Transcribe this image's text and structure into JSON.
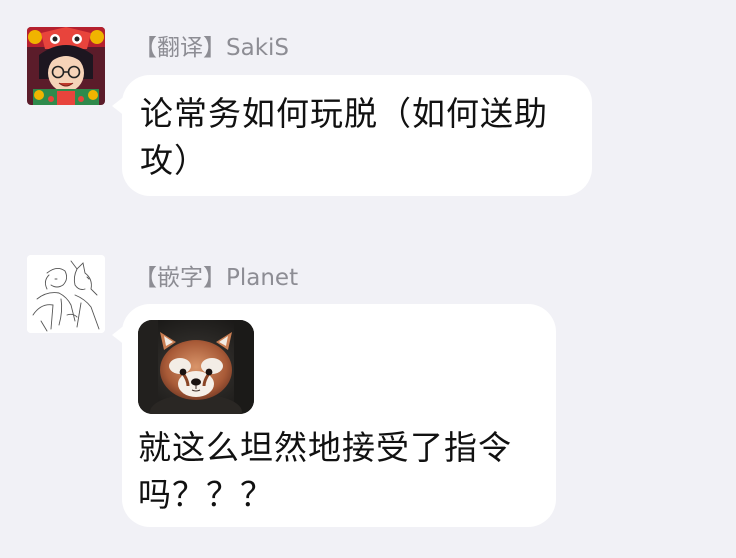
{
  "messages": [
    {
      "sender_label": "【翻译】SakiS",
      "text": "论常务如何玩脱（如何送助攻）",
      "avatar_icon": "cartoon-avatar-icon"
    },
    {
      "sender_label": "【嵌字】Planet",
      "text": "就这么坦然地接受了指令吗？？？",
      "avatar_icon": "sketch-avatar-icon",
      "image_icon": "red-panda-photo"
    }
  ],
  "colors": {
    "background": "#f1f1f6",
    "bubble": "#ffffff",
    "sender_text": "#8d8d94",
    "message_text": "#111111"
  }
}
